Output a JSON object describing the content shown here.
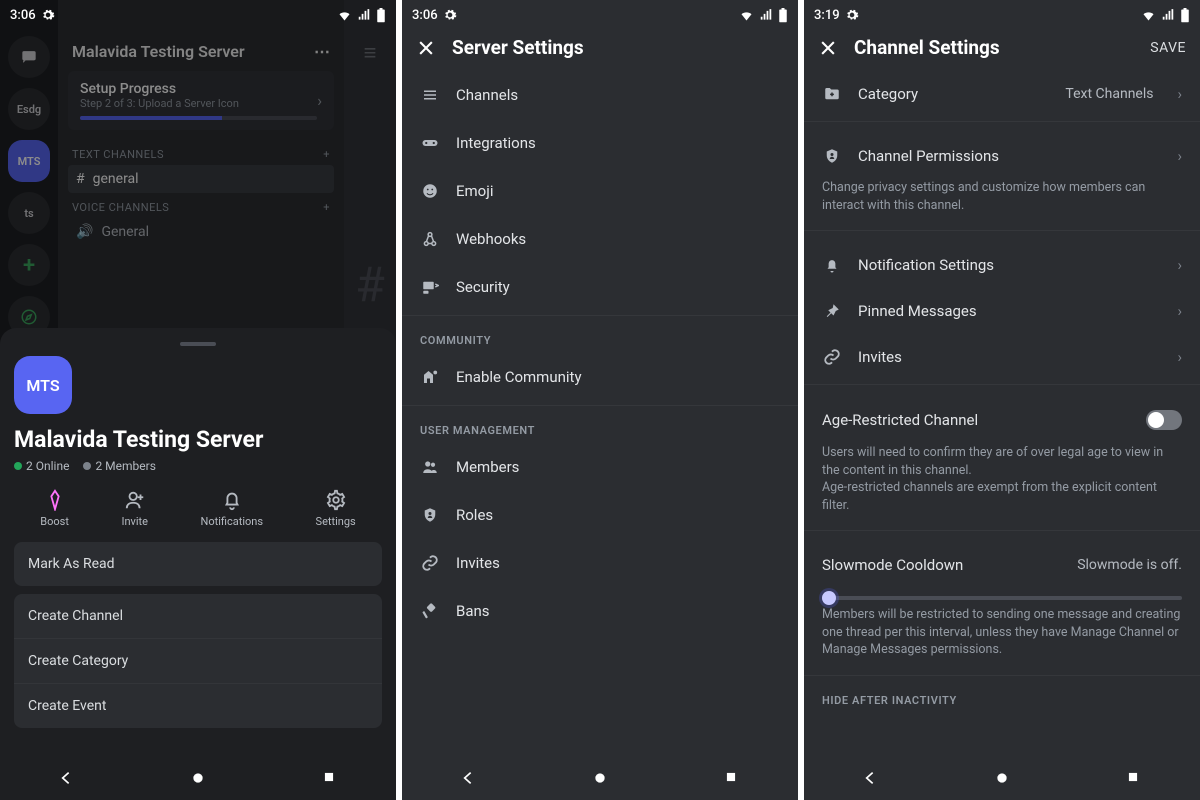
{
  "p1": {
    "status": {
      "time": "3:06"
    },
    "server_name_short": "Malavida Testing Server",
    "setup": {
      "title": "Setup Progress",
      "sub": "Step 2 of 3: Upload a Server Icon"
    },
    "rail": {
      "esdg": "Esdg",
      "mts": "MTS",
      "ts": "ts"
    },
    "cat_text": "TEXT CHANNELS",
    "cat_voice": "VOICE CHANNELS",
    "chan_general": "general",
    "chan_voice_general": "General",
    "sheet": {
      "icon": "MTS",
      "name": "Malavida Testing Server",
      "online": "2 Online",
      "members": "2 Members",
      "actions": {
        "boost": "Boost",
        "invite": "Invite",
        "notif": "Notifications",
        "settings": "Settings"
      },
      "mark_read": "Mark As Read",
      "create_channel": "Create Channel",
      "create_category": "Create Category",
      "create_event": "Create Event"
    }
  },
  "p2": {
    "status": {
      "time": "3:06"
    },
    "title": "Server Settings",
    "items": {
      "channels": "Channels",
      "integrations": "Integrations",
      "emoji": "Emoji",
      "webhooks": "Webhooks",
      "security": "Security"
    },
    "section_community": "COMMUNITY",
    "enable_community": "Enable Community",
    "section_um": "USER MANAGEMENT",
    "um": {
      "members": "Members",
      "roles": "Roles",
      "invites": "Invites",
      "bans": "Bans"
    }
  },
  "p3": {
    "status": {
      "time": "3:19"
    },
    "title": "Channel Settings",
    "save": "SAVE",
    "category": {
      "label": "Category",
      "value": "Text Channels"
    },
    "perm": {
      "label": "Channel Permissions",
      "desc": "Change privacy settings and customize how members can interact with this channel."
    },
    "notif": "Notification Settings",
    "pinned": "Pinned Messages",
    "invites": "Invites",
    "age": {
      "label": "Age-Restricted Channel",
      "desc": "Users will need to confirm they are of over legal age to view in the content in this channel.\nAge-restricted channels are exempt from the explicit content filter."
    },
    "slow": {
      "label": "Slowmode Cooldown",
      "value": "Slowmode is off.",
      "desc": "Members will be restricted to sending one message and creating one thread per this interval, unless they have Manage Channel or Manage Messages permissions."
    },
    "hide": "HIDE AFTER INACTIVITY"
  }
}
